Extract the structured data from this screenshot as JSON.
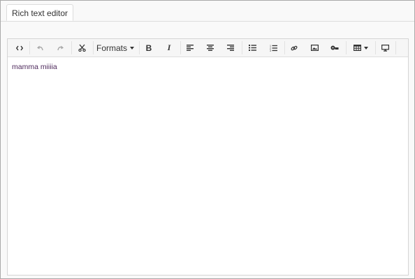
{
  "tabs": [
    {
      "label": "Rich text editor"
    }
  ],
  "toolbar": {
    "items": [
      {
        "name": "source-code",
        "icon": "code-icon"
      },
      {
        "name": "undo",
        "icon": "undo-icon",
        "disabled": true
      },
      {
        "name": "redo",
        "icon": "redo-icon",
        "disabled": true
      },
      {
        "name": "cut",
        "icon": "scissors-icon"
      },
      {
        "name": "formats",
        "label": "Formats"
      },
      {
        "name": "bold",
        "icon": "bold-icon"
      },
      {
        "name": "italic",
        "icon": "italic-icon"
      },
      {
        "name": "align-left",
        "icon": "align-left-icon"
      },
      {
        "name": "align-center",
        "icon": "align-center-icon"
      },
      {
        "name": "align-right",
        "icon": "align-right-icon"
      },
      {
        "name": "bullet-list",
        "icon": "bullet-list-icon"
      },
      {
        "name": "numbered-list",
        "icon": "numbered-list-icon"
      },
      {
        "name": "link",
        "icon": "link-icon"
      },
      {
        "name": "image",
        "icon": "image-icon"
      },
      {
        "name": "media",
        "icon": "media-icon"
      },
      {
        "name": "table",
        "icon": "table-icon"
      },
      {
        "name": "preview",
        "icon": "monitor-icon"
      }
    ],
    "formats_label": "Formats",
    "bold_glyph": "B",
    "italic_glyph": "I"
  },
  "editor": {
    "content": "mamma miiiia",
    "text_color": "#4e2a5c"
  },
  "colors": {
    "toolbar_bg": "#f6f6f6",
    "border": "#d5d5d5",
    "icon": "#333333",
    "icon_disabled": "#a8a8a8"
  }
}
